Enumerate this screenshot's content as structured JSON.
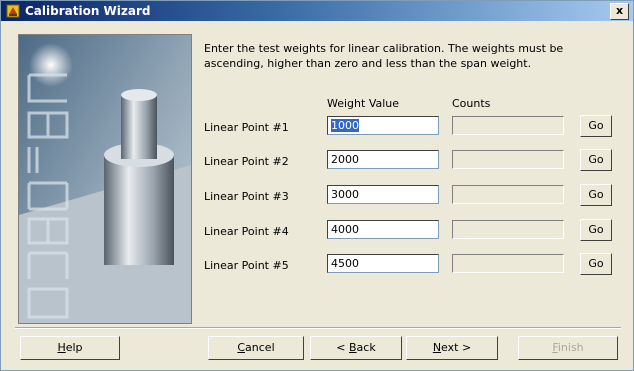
{
  "window": {
    "title": "Calibration Wizard",
    "close_label": "x"
  },
  "instructions": "Enter the test weights for linear calibration. The weights must be ascending, higher than zero and less than the span weight.",
  "columns": {
    "weight": "Weight Value",
    "counts": "Counts"
  },
  "rows": [
    {
      "label": "Linear Point #1",
      "value": "1000",
      "counts": "",
      "go": "Go"
    },
    {
      "label": "Linear Point #2",
      "value": "2000",
      "counts": "",
      "go": "Go"
    },
    {
      "label": "Linear Point #3",
      "value": "3000",
      "counts": "",
      "go": "Go"
    },
    {
      "label": "Linear Point #4",
      "value": "4000",
      "counts": "",
      "go": "Go"
    },
    {
      "label": "Linear Point #5",
      "value": "4500",
      "counts": "",
      "go": "Go"
    }
  ],
  "buttons": {
    "help": {
      "key": "H",
      "rest": "elp"
    },
    "cancel": {
      "key": "C",
      "rest": "ancel"
    },
    "back": {
      "pre": "< ",
      "key": "B",
      "rest": "ack"
    },
    "next": {
      "key": "N",
      "rest": "ext >"
    },
    "finish": {
      "key": "F",
      "rest": "inish"
    }
  },
  "side_image": {
    "icon": "calibration-wizard-image"
  }
}
